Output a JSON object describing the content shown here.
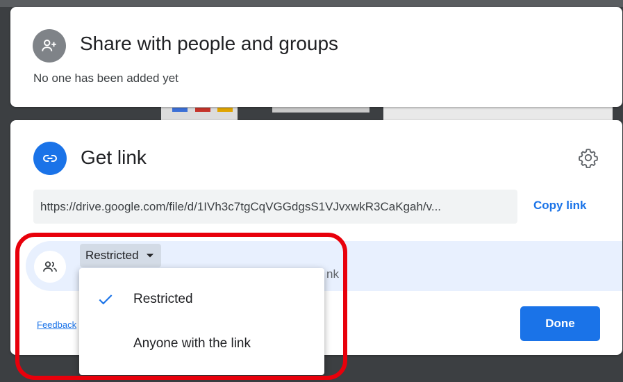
{
  "share": {
    "title": "Share with people and groups",
    "subtitle": "No one has been added yet",
    "icon": "person-add-icon"
  },
  "get_link": {
    "title": "Get link",
    "icon": "link-icon",
    "settings_icon": "gear-icon",
    "url": "https://drive.google.com/file/d/1IVh3c7tgCqVGGdgsS1VJvxwkR3CaKgah/v...",
    "copy_label": "Copy link",
    "access": {
      "selected": "Restricted",
      "icon": "people-icon",
      "description_tail": "nk",
      "options": [
        "Restricted",
        "Anyone with the link"
      ]
    },
    "feedback_label": "Feedback",
    "done_label": "Done"
  },
  "colors": {
    "accent": "#1a73e8",
    "highlight": "#e8000b",
    "access_row_bg": "#e8f0fe",
    "url_bg": "#f1f3f4"
  }
}
